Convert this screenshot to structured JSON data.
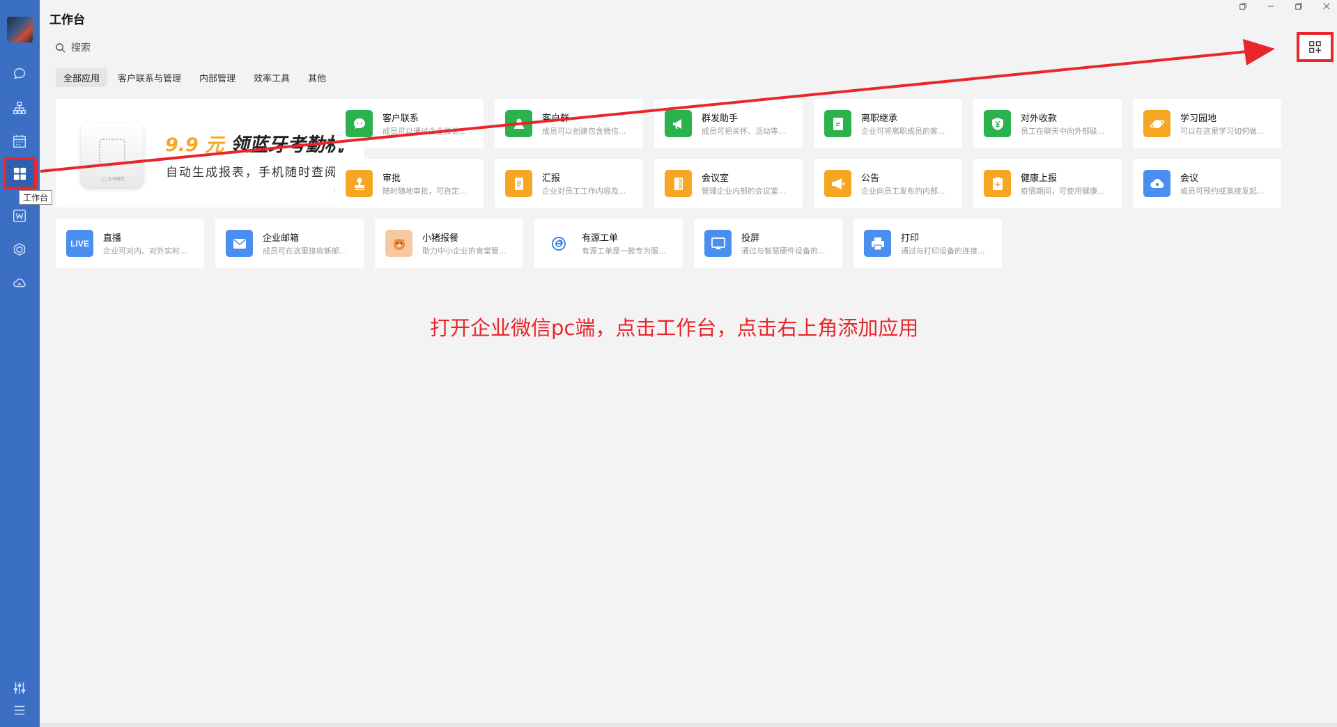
{
  "app": {
    "title": "工作台",
    "tooltip": "工作台",
    "search_placeholder": "搜索"
  },
  "tabs": [
    "全部应用",
    "客户联系与管理",
    "内部管理",
    "效率工具",
    "其他"
  ],
  "banner": {
    "price": "9.9 元",
    "headline": "领蓝牙考勤机",
    "subtitle": "自动生成报表，手机随时查阅"
  },
  "apps": [
    {
      "name": "客户联系",
      "desc": "成员可以通过企业微信...",
      "color": "#2bb24c",
      "icon": "chat-bubble-icon"
    },
    {
      "name": "客户群",
      "desc": "成员可以创建包含微信...",
      "color": "#2bb24c",
      "icon": "people-group-icon"
    },
    {
      "name": "群发助手",
      "desc": "成员可把关怀、活动等...",
      "color": "#2bb24c",
      "icon": "megaphone-icon"
    },
    {
      "name": "离职继承",
      "desc": "企业可将离职成员的客...",
      "color": "#2bb24c",
      "icon": "handover-icon"
    },
    {
      "name": "对外收款",
      "desc": "员工在聊天中向外部联...",
      "color": "#2bb24c",
      "icon": "yuan-shield-icon"
    },
    {
      "name": "学习园地",
      "desc": "可以在这里学习如何做...",
      "color": "#f5a623",
      "icon": "planet-icon"
    },
    {
      "name": "审批",
      "desc": "随时随地审批，可自定...",
      "color": "#f5a623",
      "icon": "stamp-icon"
    },
    {
      "name": "汇报",
      "desc": "企业对员工工作内容及...",
      "color": "#f5a623",
      "icon": "report-icon"
    },
    {
      "name": "会议室",
      "desc": "管理企业内部的会议室...",
      "color": "#f5a623",
      "icon": "door-icon"
    },
    {
      "name": "公告",
      "desc": "企业向员工发布的内部...",
      "color": "#f5a623",
      "icon": "announcement-icon"
    },
    {
      "name": "健康上报",
      "desc": "疫情期间，可使用健康...",
      "color": "#f5a623",
      "icon": "health-clipboard-icon"
    },
    {
      "name": "会议",
      "desc": "成员可预约或直接发起...",
      "color": "#4a8ef0",
      "icon": "cloud-meeting-icon"
    },
    {
      "name": "直播",
      "desc": "企业可对内、对外实时...",
      "color": "#4a8ef0",
      "icon": "live-icon",
      "label": "LIVE"
    },
    {
      "name": "企业邮箱",
      "desc": "成员可在这里接收新邮...",
      "color": "#4a8ef0",
      "icon": "mail-icon"
    },
    {
      "name": "小猪报餐",
      "desc": "助力中小企业的食堂管...",
      "color": "#f7c9a0",
      "icon": "pig-icon"
    },
    {
      "name": "有源工单",
      "desc": "有源工单是一款专为服...",
      "color": "#ffffff",
      "icon": "workorder-icon"
    },
    {
      "name": "投屏",
      "desc": "通过与智慧硬件设备的...",
      "color": "#4a8ef0",
      "icon": "screen-cast-icon"
    },
    {
      "name": "打印",
      "desc": "通过与打印设备的连接...",
      "color": "#4a8ef0",
      "icon": "printer-icon"
    }
  ],
  "annotation": "打开企业微信pc端，点击工作台，点击右上角添加应用",
  "colors": {
    "sidebar": "#3b6fc3",
    "highlight": "#e8262b",
    "green": "#2bb24c",
    "orange": "#f5a623",
    "blue": "#4a8ef0"
  }
}
